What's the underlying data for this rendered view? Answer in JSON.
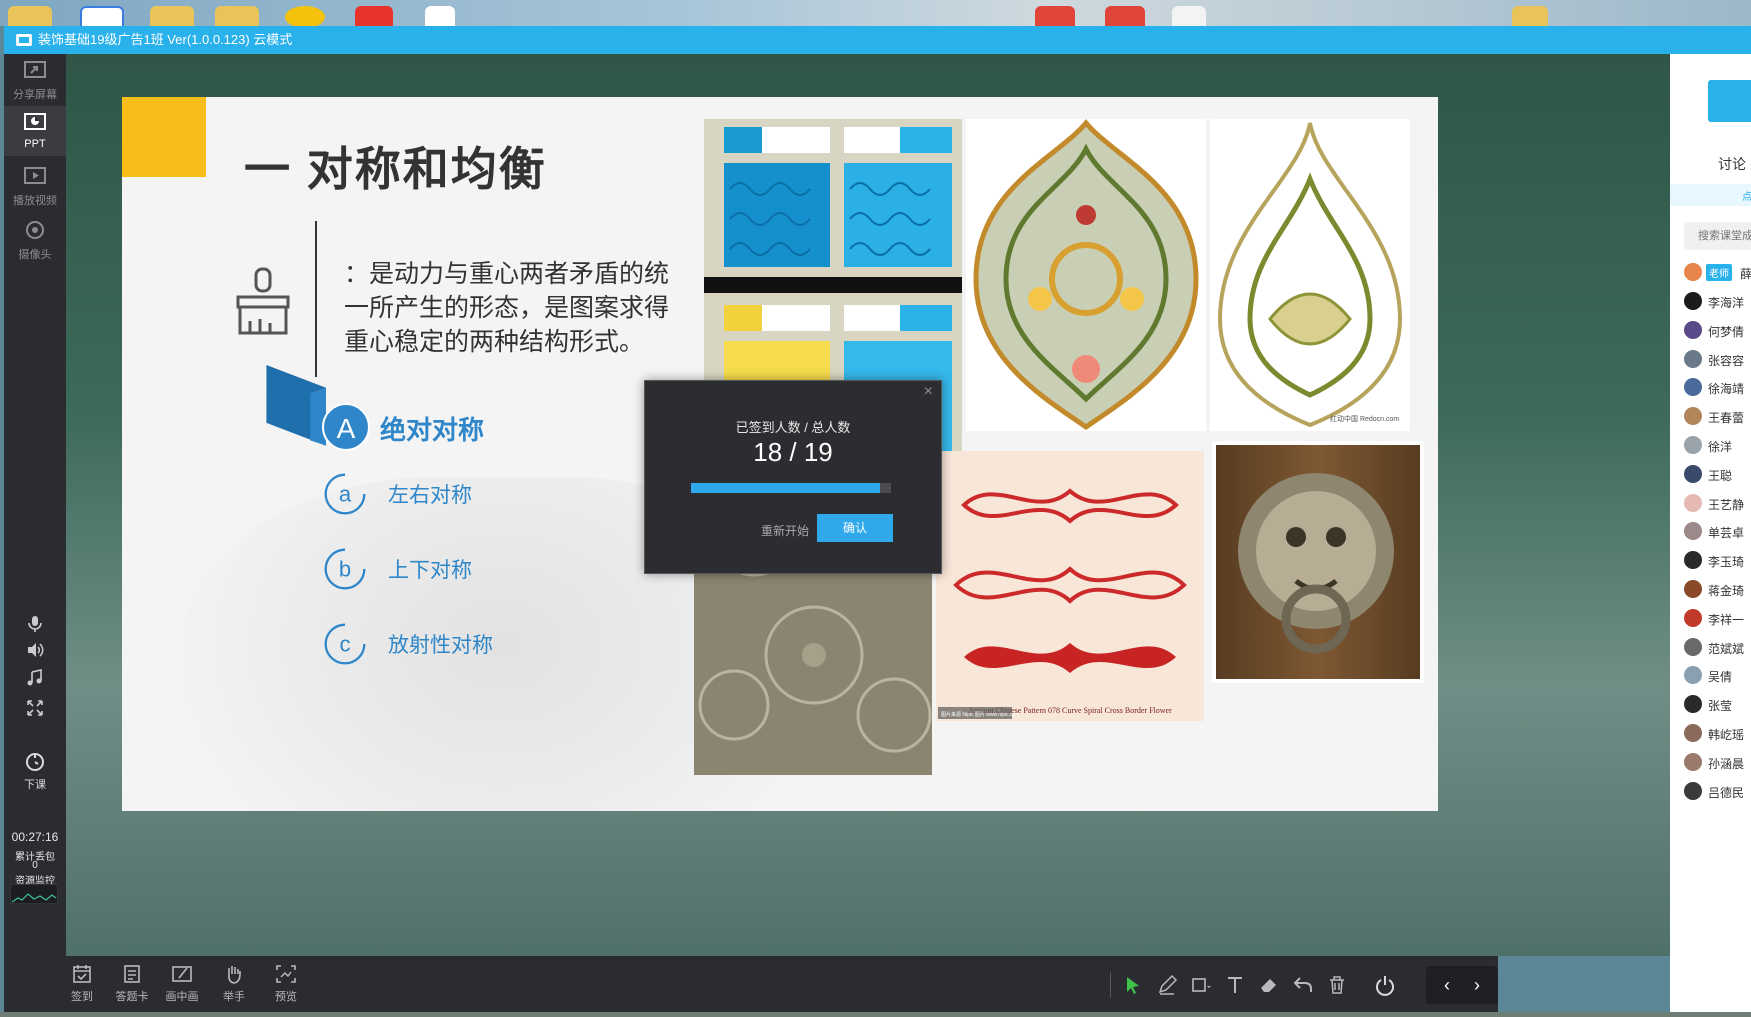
{
  "window": {
    "title": "装饰基础19级广告1班 Ver(1.0.0.123) 云模式"
  },
  "sidebar": {
    "items": [
      {
        "label": "分享屏幕",
        "icon": "share-screen-icon"
      },
      {
        "label": "PPT",
        "icon": "ppt-icon"
      },
      {
        "label": "播放视频",
        "icon": "play-video-icon"
      },
      {
        "label": "摄像头",
        "icon": "camera-icon"
      }
    ],
    "end_class_label": "下课",
    "timer": "00:27:16",
    "packet_loss_label": "累计丢包",
    "packet_loss_value": "0",
    "resource_monitor_label": "资源监控"
  },
  "slide": {
    "title": "一 对称和均衡",
    "description": "：是动力与重心两者矛盾的统一所产生的形态，是图案求得重心稳定的两种结构形式。",
    "section_letter": "A",
    "section_heading": "绝对对称",
    "sub_items": [
      {
        "letter": "a",
        "label": "左右对称"
      },
      {
        "letter": "b",
        "label": "上下对称"
      },
      {
        "letter": "c",
        "label": "放射性对称"
      }
    ],
    "image_captions": {
      "ornament_credit": "红动中国 Redocn.com",
      "pattern_caption": "Ancient Chinese Pattern 078 Curve Spiral Cross Border Flower",
      "watermark": "图片来源 Nipic 图片 www.nipic.com"
    }
  },
  "checkin_dialog": {
    "label": "已签到人数 / 总人数",
    "count_text": "18 / 19",
    "checked_in": 18,
    "total": 19,
    "progress_fraction": 0.947,
    "restart_label": "重新开始",
    "confirm_label": "确认",
    "close_glyph": "×"
  },
  "toolbar": {
    "tools": [
      {
        "label": "签到",
        "icon": "checkin-icon"
      },
      {
        "label": "答题卡",
        "icon": "answer-card-icon"
      },
      {
        "label": "画中画",
        "icon": "picture-in-picture-icon"
      },
      {
        "label": "举手",
        "icon": "raise-hand-icon"
      },
      {
        "label": "预览",
        "icon": "preview-icon"
      }
    ],
    "nav_prev": "‹",
    "nav_next": "›"
  },
  "right_panel": {
    "tab_label": "讨论",
    "strip_text": "点",
    "search_placeholder": "搜索课堂成员",
    "teacher_tag": "老师",
    "teacher_name": "薛",
    "members": [
      "李海洋",
      "何梦倩",
      "张容容",
      "徐海靖",
      "王春蕾",
      "徐洋",
      "王聪",
      "王艺静",
      "单芸卓",
      "李玉琦",
      "蒋金琦",
      "李祥一",
      "范斌斌",
      "吴倩",
      "张莹",
      "韩屹瑶",
      "孙涵晨",
      "吕德民"
    ]
  },
  "colors": {
    "accent_blue": "#29b1ec",
    "slide_blue": "#2f86c9",
    "slide_yellow": "#f7be1a",
    "dark_panel": "#2b2c31"
  }
}
